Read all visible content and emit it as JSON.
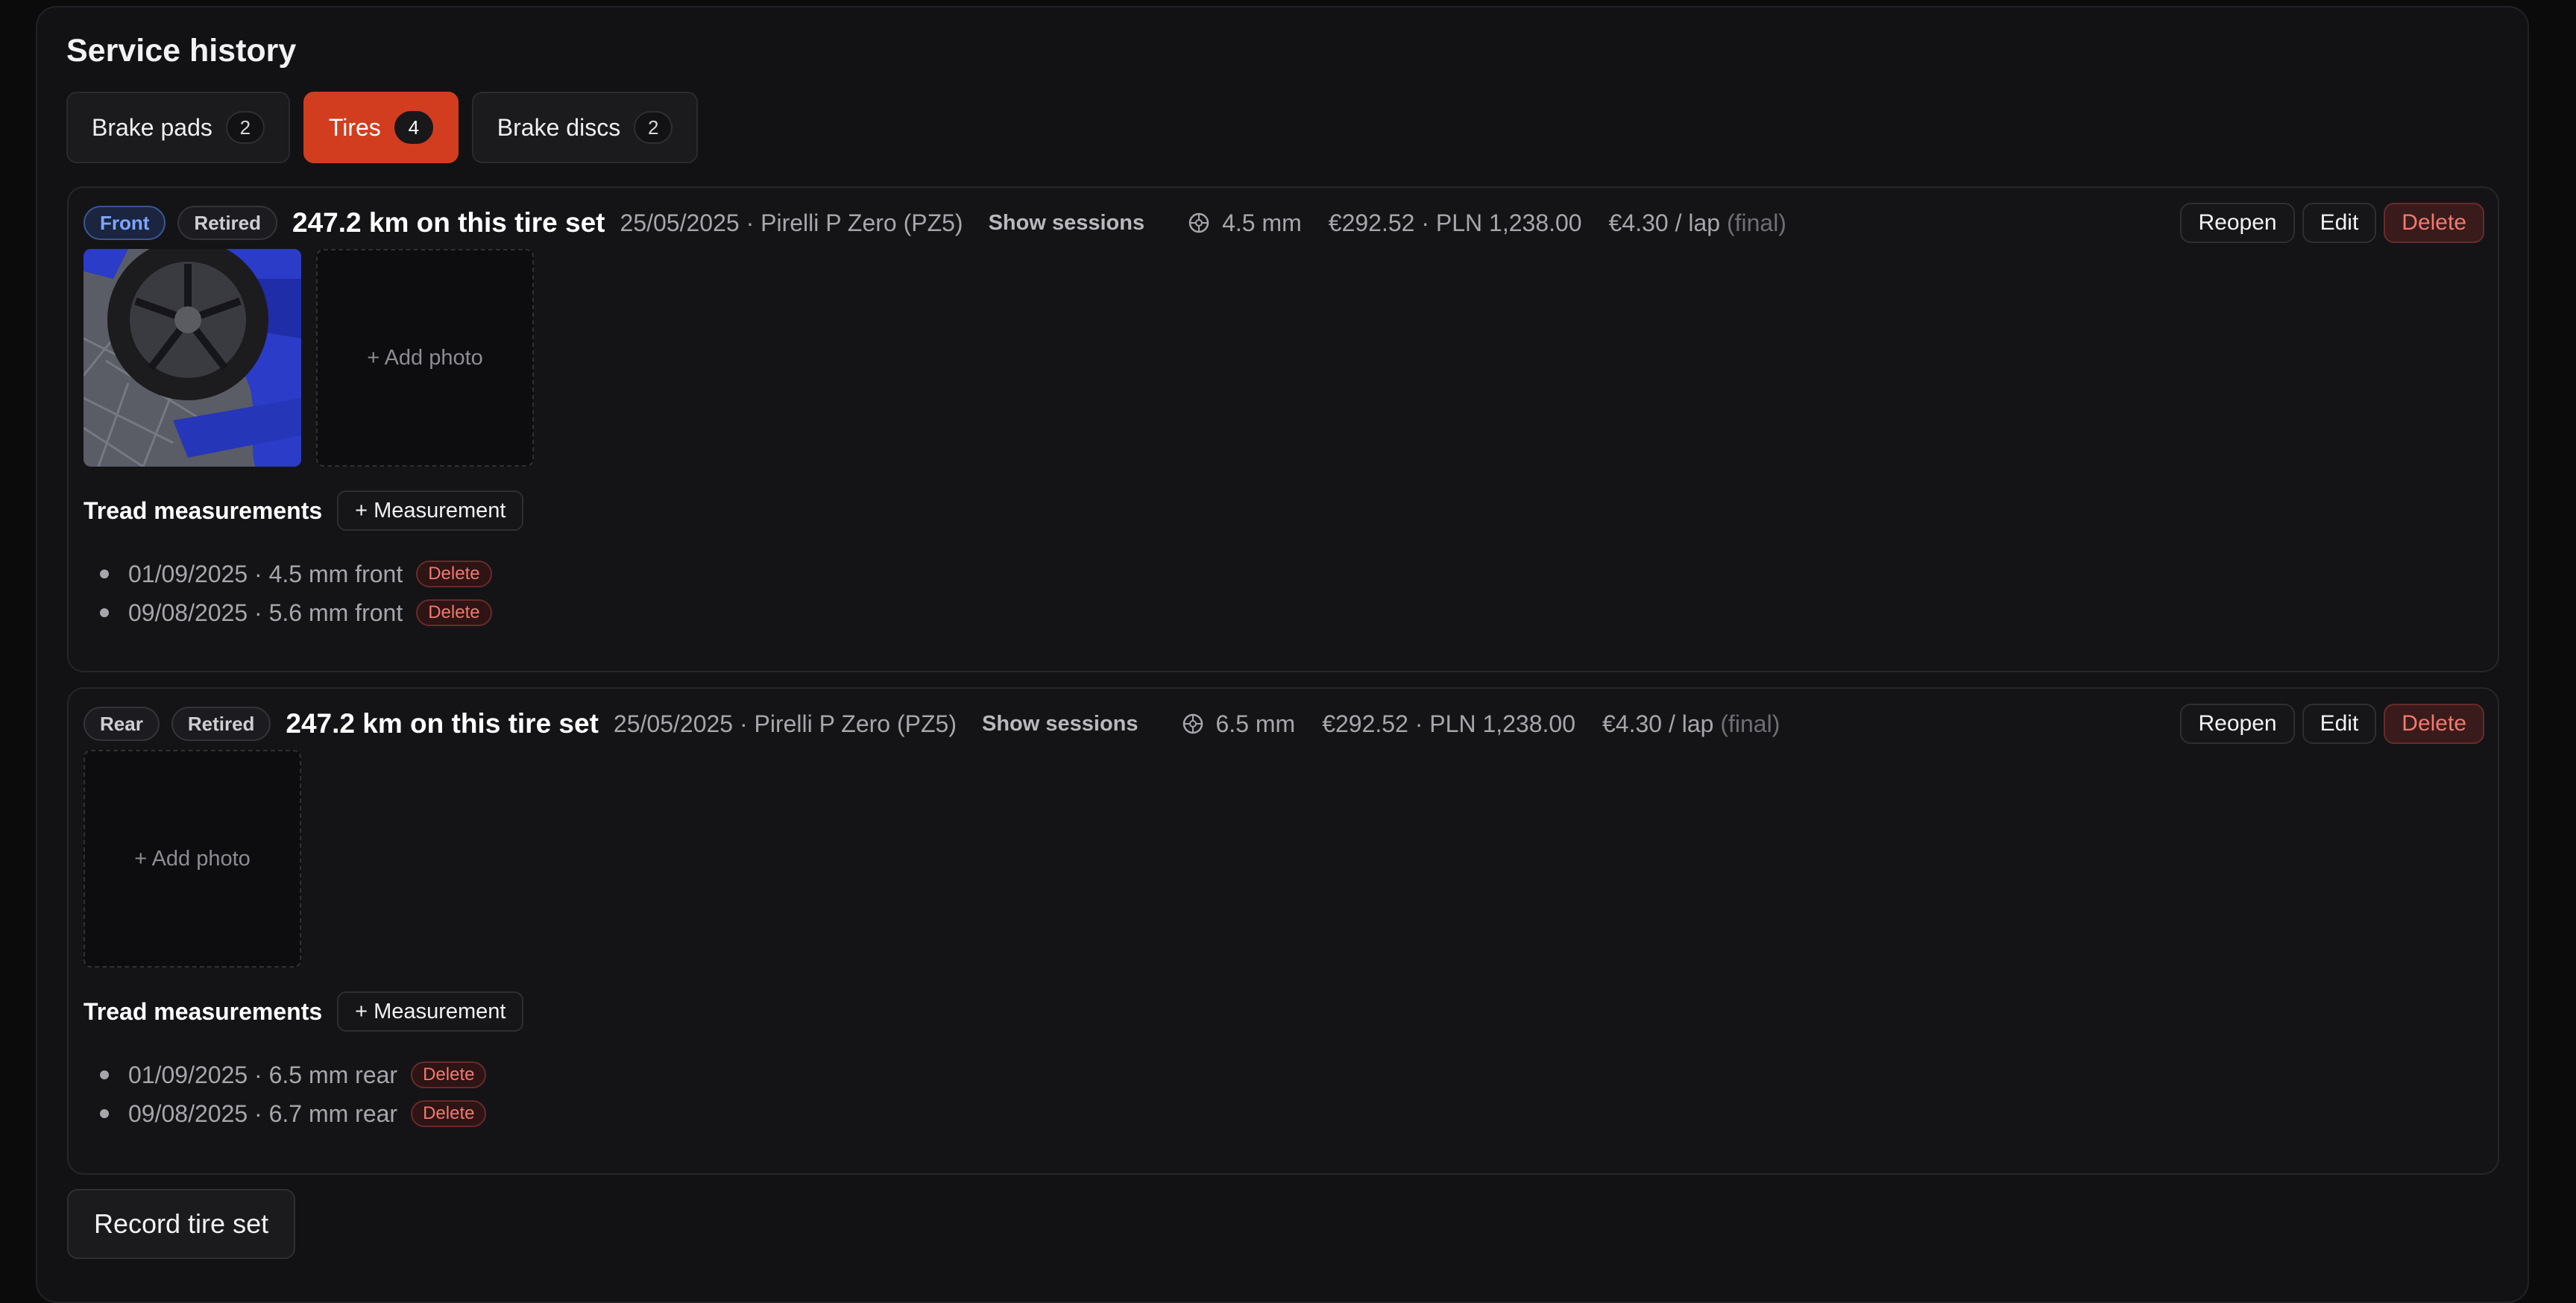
{
  "section": {
    "title": "Service history"
  },
  "tabs": [
    {
      "label": "Brake pads",
      "count": "2",
      "active": false
    },
    {
      "label": "Tires",
      "count": "4",
      "active": true
    },
    {
      "label": "Brake discs",
      "count": "2",
      "active": false
    }
  ],
  "tire_sets": [
    {
      "position": "Front",
      "status": "Retired",
      "distance": "247.2 km on this tire set",
      "details": "25/05/2025 · Pirelli P Zero (PZ5)",
      "show_sessions": "Show sessions",
      "tread_depth": "4.5 mm",
      "cost": "€292.52 · PLN 1,238.00",
      "per_lap": "€4.30 / lap",
      "per_lap_note": "(final)",
      "actions": {
        "reopen": "Reopen",
        "edit": "Edit",
        "delete": "Delete"
      },
      "add_photo": "+ Add photo",
      "tread_label": "Tread measurements",
      "add_measurement": "+ Measurement",
      "measurements": [
        {
          "text": "01/09/2025 · 4.5 mm front",
          "delete": "Delete"
        },
        {
          "text": "09/08/2025 · 5.6 mm front",
          "delete": "Delete"
        }
      ]
    },
    {
      "position": "Rear",
      "status": "Retired",
      "distance": "247.2 km on this tire set",
      "details": "25/05/2025 · Pirelli P Zero (PZ5)",
      "show_sessions": "Show sessions",
      "tread_depth": "6.5 mm",
      "cost": "€292.52 · PLN 1,238.00",
      "per_lap": "€4.30 / lap",
      "per_lap_note": "(final)",
      "actions": {
        "reopen": "Reopen",
        "edit": "Edit",
        "delete": "Delete"
      },
      "add_photo": "+ Add photo",
      "tread_label": "Tread measurements",
      "add_measurement": "+ Measurement",
      "measurements": [
        {
          "text": "01/09/2025 · 6.5 mm rear",
          "delete": "Delete"
        },
        {
          "text": "09/08/2025 · 6.7 mm rear",
          "delete": "Delete"
        }
      ]
    }
  ],
  "record_button": "Record tire set",
  "colors": {
    "accent": "#d23d1f",
    "danger": "#f07a6f",
    "front_badge": "#7ea6ff"
  },
  "icons": {
    "tread": "tire-icon"
  }
}
